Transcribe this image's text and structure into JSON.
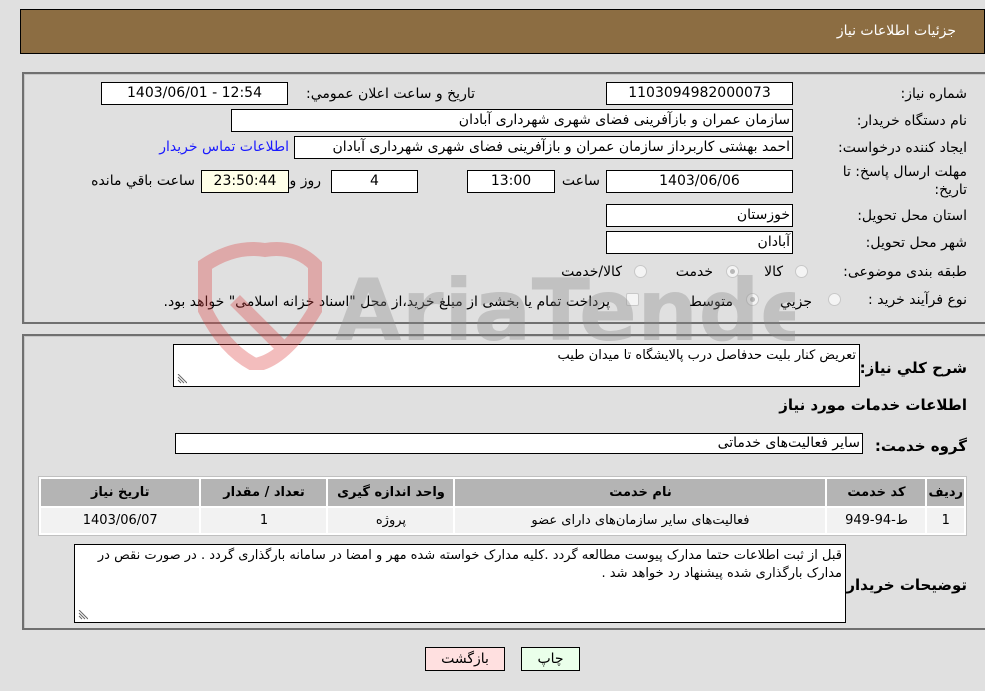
{
  "header": {
    "title": "جزئيات اطلاعات نياز"
  },
  "details": {
    "need_number_label": "شماره نياز:",
    "need_number": "1103094982000073",
    "announce_label": "تاريخ و ساعت اعلان عمومي:",
    "announce_value": "1403/06/01 - 12:54",
    "buyer_org_label": "نام دستگاه خريدار:",
    "buyer_org": "سازمان عمران و بازآفرينی فضای شهری شهرداری آبادان",
    "requester_label": "ايجاد کننده درخواست:",
    "requester": "احمد بهشتی کاربرداز سازمان عمران و بازآفرينی فضای شهری شهرداری آبادان",
    "contact_link": "اطلاعات تماس خريدار",
    "deadline_label_line1": "مهلت ارسال پاسخ: تا",
    "deadline_label_line2": "تاريخ:",
    "deadline_date": "1403/06/06",
    "time_label": "ساعت",
    "deadline_time": "13:00",
    "days_value": "4",
    "days_label": "روز و",
    "remaining_time": "23:50:44",
    "remaining_label": "ساعت باقي مانده",
    "province_label": "استان محل تحويل:",
    "province": "خوزستان",
    "city_label": "شهر محل تحويل:",
    "city": "آبادان",
    "category_label": "طبقه بندی موضوعی:",
    "category_options": [
      {
        "label": "کالا",
        "selected": false
      },
      {
        "label": "خدمت",
        "selected": true
      },
      {
        "label": "کالا/خدمت",
        "selected": false
      }
    ],
    "process_label": "نوع فرآيند خريد :",
    "process_options": [
      {
        "label": "جزيي",
        "selected": false
      },
      {
        "label": "متوسط",
        "selected": true
      }
    ],
    "treasury_checkbox_label": "پرداخت تمام يا بخشی از مبلغ خريد،از محل \"اسناد خزانه اسلامی\" خواهد بود.",
    "treasury_checked": false
  },
  "need": {
    "summary_label": "شرح کلي نياز:",
    "summary": "تعريض کنار بليت حدفاصل درب پالايشگاه تا ميدان طيب",
    "services_heading": "اطلاعات خدمات مورد نياز",
    "service_group_label": "گروه خدمت:",
    "service_group": "ساير فعاليت‌های خدماتی",
    "table": {
      "headers": [
        "رديف",
        "کد خدمت",
        "نام خدمت",
        "واحد اندازه گيری",
        "تعداد / مقدار",
        "تاريخ نياز"
      ],
      "rows": [
        [
          "1",
          "ط-94-949",
          "فعاليت‌های ساير سازمان‌های دارای عضو",
          "پروژه",
          "1",
          "1403/06/07"
        ]
      ]
    },
    "buyer_notes_label": "توضيحات خريدار:",
    "buyer_notes": "قبل از ثبت اطلاعات حتما مدارک پيوست مطالعه گردد .کليه مدارک خواسته شده مهر و امضا در سامانه بارگذاری گردد . در صورت نقص در مدارک بارگذاری شده پيشنهاد رد خواهد شد ."
  },
  "buttons": {
    "print": "چاپ",
    "back": "بازگشت"
  },
  "watermark": {
    "text": "AriaTender.neT"
  }
}
